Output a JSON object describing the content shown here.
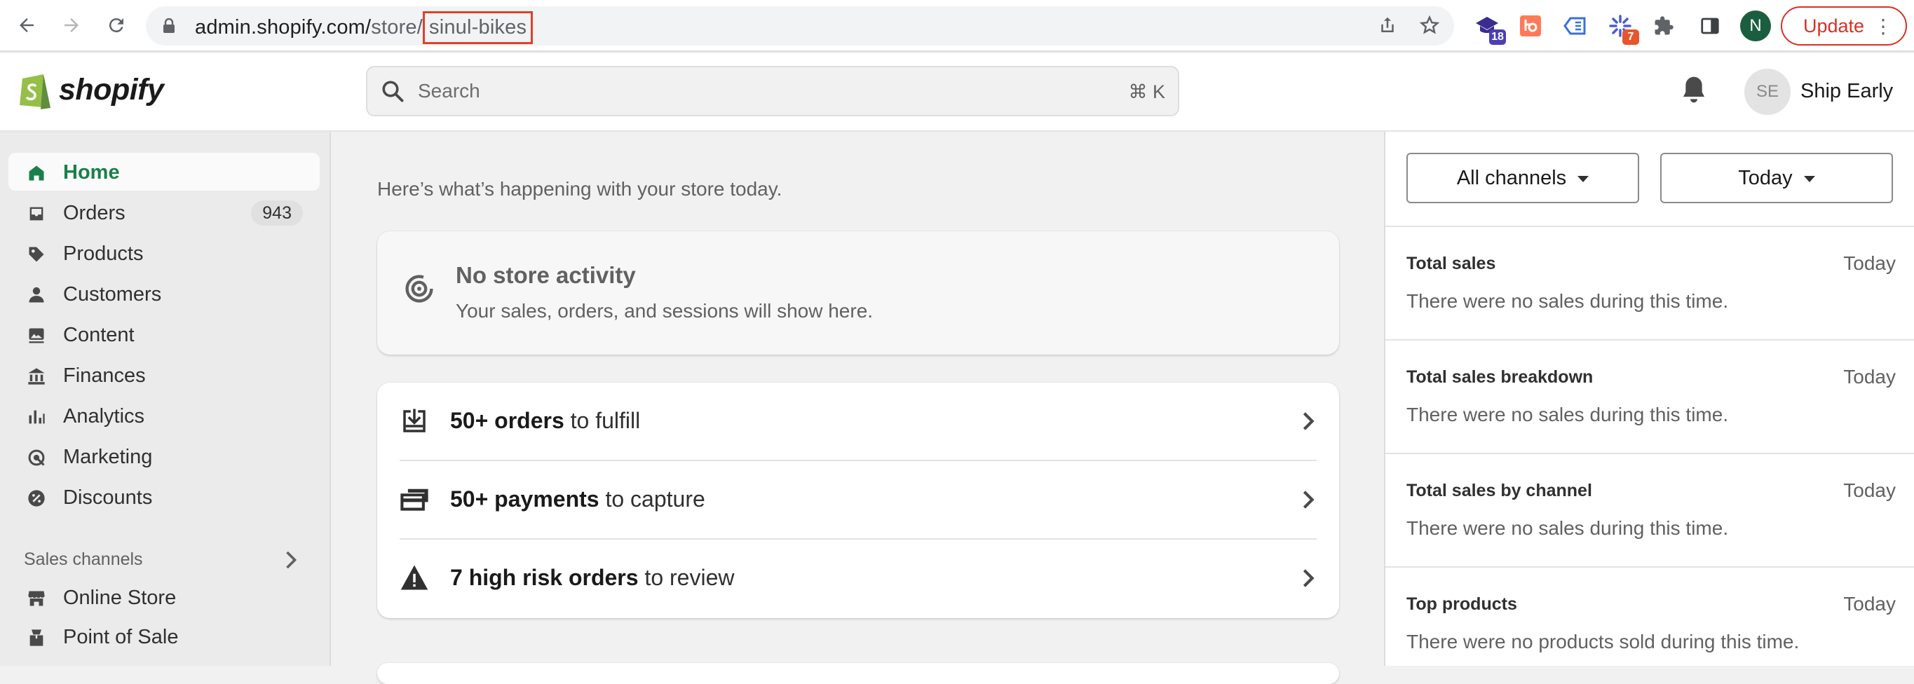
{
  "browser": {
    "url_host": "admin.shopify.com/",
    "url_path_dim": "store/",
    "url_highlight": "sinul-bikes",
    "extension_badges": [
      "18",
      "7"
    ],
    "profile_initial": "N",
    "update_label": "Update",
    "colors": {
      "update": "#d93025",
      "highlight_box": "#e0402a",
      "profile": "#1b5e3f"
    }
  },
  "topbar": {
    "logo_text": "shopify",
    "search_placeholder": "Search",
    "search_shortcut": "⌘ K",
    "avatar_initials": "SE",
    "store_name": "Ship Early"
  },
  "sidebar": {
    "items": [
      {
        "label": "Home",
        "icon": "home-icon",
        "active": true
      },
      {
        "label": "Orders",
        "icon": "inbox-icon",
        "count": "943"
      },
      {
        "label": "Products",
        "icon": "tag-icon"
      },
      {
        "label": "Customers",
        "icon": "person-icon"
      },
      {
        "label": "Content",
        "icon": "image-icon"
      },
      {
        "label": "Finances",
        "icon": "bank-icon"
      },
      {
        "label": "Analytics",
        "icon": "bar-chart-icon"
      },
      {
        "label": "Marketing",
        "icon": "target-icon"
      },
      {
        "label": "Discounts",
        "icon": "discount-icon"
      }
    ],
    "section_label": "Sales channels",
    "channels": [
      {
        "label": "Online Store",
        "icon": "store-icon"
      },
      {
        "label": "Point of Sale",
        "icon": "pos-icon"
      }
    ],
    "colors": {
      "active_text": "#1a7f4b"
    }
  },
  "main": {
    "intro": "Here’s what’s happening with your store today.",
    "activity": {
      "title": "No store activity",
      "subtitle": "Your sales, orders, and sessions will show here."
    },
    "tasks": [
      {
        "bold": "50+ orders",
        "rest": " to fulfill",
        "icon": "fulfill-icon"
      },
      {
        "bold": "50+ payments",
        "rest": " to capture",
        "icon": "payment-icon"
      },
      {
        "bold": "7 high risk orders",
        "rest": " to review",
        "icon": "warning-icon"
      }
    ]
  },
  "right_panel": {
    "channel_filter": "All channels",
    "date_filter": "Today",
    "metrics": [
      {
        "title": "Total sales",
        "when": "Today",
        "desc": "There were no sales during this time."
      },
      {
        "title": "Total sales breakdown",
        "when": "Today",
        "desc": "There were no sales during this time."
      },
      {
        "title": "Total sales by channel",
        "when": "Today",
        "desc": "There were no sales during this time."
      },
      {
        "title": "Top products",
        "when": "Today",
        "desc": "There were no products sold during this time."
      }
    ]
  }
}
